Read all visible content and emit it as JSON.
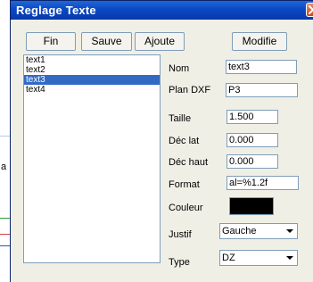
{
  "window": {
    "title": "Reglage Texte"
  },
  "toolbar": {
    "fin_label": "Fin",
    "sauve_label": "Sauve",
    "ajoute_label": "Ajoute",
    "modifie_label": "Modifie"
  },
  "list": {
    "items": [
      "text1",
      "text2",
      "text3",
      "text4"
    ],
    "selected": "text3"
  },
  "form": {
    "nom_label": "Nom",
    "nom_value": "text3",
    "plan_label": "Plan DXF",
    "plan_value": "P3",
    "taille_label": "Taille",
    "taille_value": "1.500",
    "declat_label": "Déc lat",
    "declat_value": "0.000",
    "dechaut_label": "Déc haut",
    "dechaut_value": "0.000",
    "format_label": "Format",
    "format_value": "al=%1.2f",
    "couleur_label": "Couleur",
    "couleur_value": "#000000",
    "justif_label": "Justif",
    "justif_value": "Gauche",
    "type_label": "Type",
    "type_value": "DZ"
  },
  "background": {
    "partial_text": "a"
  },
  "colors": {
    "title_bar": "#0b48c4",
    "selection": "#316ac5",
    "dialog_bg": "#f0efe6"
  }
}
